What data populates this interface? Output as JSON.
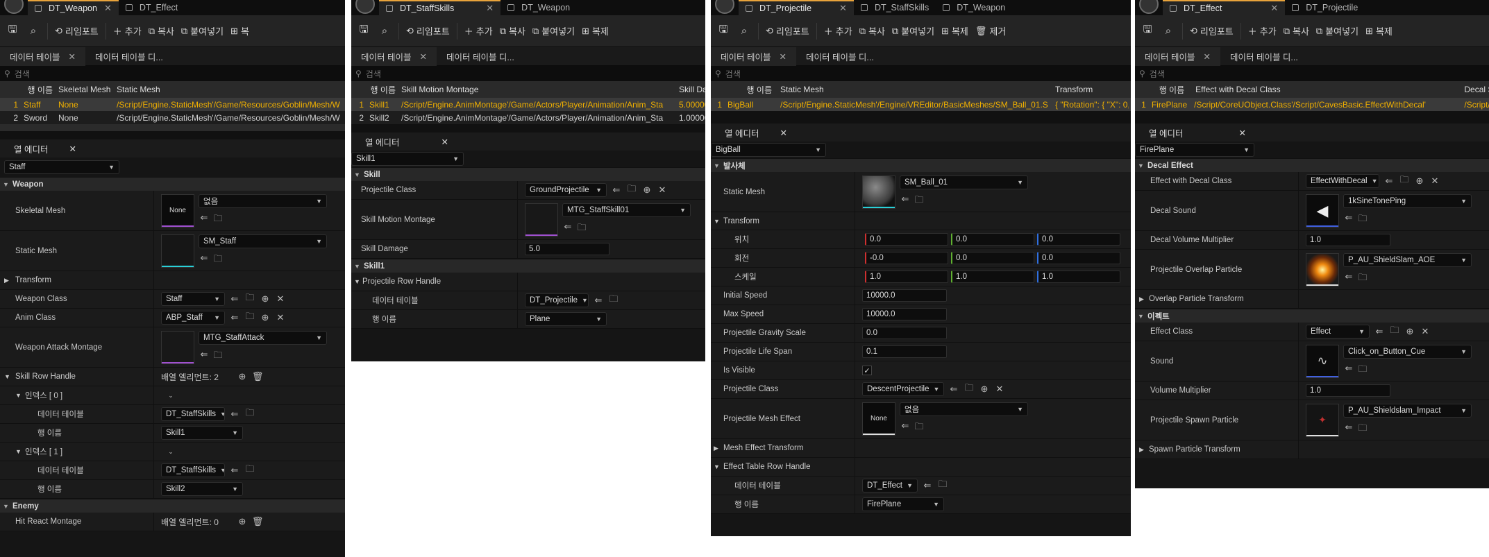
{
  "common": {
    "import": "리임포트",
    "add": "추가",
    "copy": "복사",
    "paste": "붙여넣기",
    "duplicate": "복제",
    "remove": "제거",
    "data_table_tab": "데이터 테이블",
    "data_table_tab2": "데이터 테이블 디...",
    "search": "검색",
    "row_name_col": "행 이름",
    "col_editor": "열 에디터",
    "data_table_label": "데이터 테이블",
    "row_name_label": "행 이름",
    "none": "None",
    "none_kr": "없음"
  },
  "p1": {
    "tabs": [
      "DT_Weapon",
      "DT_Effect"
    ],
    "toolbar_dup": "복",
    "headers": [
      "Skeletal Mesh",
      "Static Mesh"
    ],
    "rows": [
      {
        "n": "1",
        "name": "Staff",
        "skm": "None",
        "sm": "/Script/Engine.StaticMesh'/Game/Resources/Goblin/Mesh/W"
      },
      {
        "n": "2",
        "name": "Sword",
        "skm": "None",
        "sm": "/Script/Engine.StaticMesh'/Game/Resources/Goblin/Mesh/W"
      }
    ],
    "selected_row": "Staff",
    "cat_weapon": "Weapon",
    "skeletal_mesh": "Skeletal Mesh",
    "skeletal_val": "없음",
    "static_mesh": "Static Mesh",
    "static_val": "SM_Staff",
    "transform": "Transform",
    "weapon_class": "Weapon Class",
    "weapon_class_val": "Staff",
    "anim_class": "Anim Class",
    "anim_class_val": "ABP_Staff",
    "attack_montage": "Weapon Attack Montage",
    "attack_montage_val": "MTG_StaffAttack",
    "skill_row_handle": "Skill Row Handle",
    "array_elems": "배열 엘리먼트: 2",
    "index0": "인덱스 [ 0 ]",
    "index1": "인덱스 [ 1 ]",
    "dt_val": "DT_StaffSkills",
    "skill1": "Skill1",
    "skill2": "Skill2",
    "cat_enemy": "Enemy",
    "hit_react": "Hit React Montage",
    "array_elems0": "배열 엘리먼트: 0"
  },
  "p2": {
    "tabs": [
      "DT_StaffSkills",
      "DT_Weapon"
    ],
    "toolbar_dup": "복제",
    "headers": [
      "행 이름",
      "Skill Motion Montage",
      "Skill Da"
    ],
    "rows": [
      {
        "n": "1",
        "name": "Skill1",
        "mm": "/Script/Engine.AnimMontage'/Game/Actors/Player/Animation/Anim_Sta",
        "dmg": "5.00000"
      },
      {
        "n": "2",
        "name": "Skill2",
        "mm": "/Script/Engine.AnimMontage'/Game/Actors/Player/Animation/Anim_Sta",
        "dmg": "1.00000"
      }
    ],
    "selected_row": "Skill1",
    "cat_skill": "Skill",
    "projectile_class": "Projectile Class",
    "projectile_class_val": "GroundProjectile",
    "motion_montage": "Skill Motion Montage",
    "motion_montage_val": "MTG_StaffSkill01",
    "skill_damage": "Skill Damage",
    "skill_damage_val": "5.0",
    "cat_skill1": "Skill1",
    "proj_row_handle": "Projectile Row Handle",
    "dt_val": "DT_Projectile",
    "row_val": "Plane"
  },
  "p3": {
    "tabs": [
      "DT_Projectile",
      "DT_StaffSkills",
      "DT_Weapon"
    ],
    "headers": [
      "Static Mesh",
      "Transform"
    ],
    "rows": [
      {
        "n": "1",
        "name": "BigBall",
        "sm": "/Script/Engine.StaticMesh'/Engine/VREditor/BasicMeshes/SM_Ball_01.S",
        "tr": "{ \"Rotation\": { \"X\": 0,"
      }
    ],
    "selected_row": "BigBall",
    "cat_proj": "발사체",
    "static_mesh": "Static Mesh",
    "static_val": "SM_Ball_01",
    "transform": "Transform",
    "loc": "위치",
    "rot": "회전",
    "scale": "스케일",
    "loc_v": [
      "0.0",
      "0.0",
      "0.0"
    ],
    "rot_v": [
      "-0.0",
      "0.0",
      "0.0"
    ],
    "scale_v": [
      "1.0",
      "1.0",
      "1.0"
    ],
    "initial_speed": "Initial Speed",
    "initial_speed_val": "10000.0",
    "max_speed": "Max Speed",
    "max_speed_val": "10000.0",
    "gravity": "Projectile Gravity Scale",
    "gravity_val": "0.0",
    "life_span": "Projectile Life Span",
    "life_span_val": "0.1",
    "is_visible": "Is Visible",
    "proj_class": "Projectile Class",
    "proj_class_val": "DescentProjectile",
    "mesh_effect": "Projectile Mesh Effect",
    "mesh_effect_val": "없음",
    "mesh_effect_tr": "Mesh Effect Transform",
    "effect_row_handle": "Effect Table Row Handle",
    "dt_val": "DT_Effect",
    "row_val": "FirePlane"
  },
  "p4": {
    "tabs": [
      "DT_Effect",
      "DT_Projectile"
    ],
    "toolbar_dup": "복제",
    "headers": [
      "Effect with Decal Class",
      "Decal Sou"
    ],
    "rows": [
      {
        "n": "1",
        "name": "FirePlane",
        "cls": "/Script/CoreUObject.Class'/Script/CavesBasic.EffectWithDecal'",
        "ds": "/Script/Eng"
      }
    ],
    "selected_row": "FirePlane",
    "cat_decal": "Decal Effect",
    "effect_decal_class": "Effect with Decal Class",
    "effect_decal_class_val": "EffectWithDecal",
    "decal_sound": "Decal Sound",
    "decal_sound_val": "1kSineTonePing",
    "decal_vol": "Decal Volume Multiplier",
    "decal_vol_val": "1.0",
    "overlap_particle": "Projectile Overlap Particle",
    "overlap_particle_val": "P_AU_ShieldSlam_AOE",
    "overlap_tr": "Overlap Particle Transform",
    "cat_effect": "이펙트",
    "effect_class": "Effect Class",
    "effect_class_val": "Effect",
    "sound": "Sound",
    "sound_val": "Click_on_Button_Cue",
    "vol_mult": "Volume Multiplier",
    "vol_mult_val": "1.0",
    "spawn_particle": "Projectile Spawn Particle",
    "spawn_particle_val": "P_AU_Shieldslam_Impact",
    "spawn_tr": "Spawn Particle Transform"
  }
}
